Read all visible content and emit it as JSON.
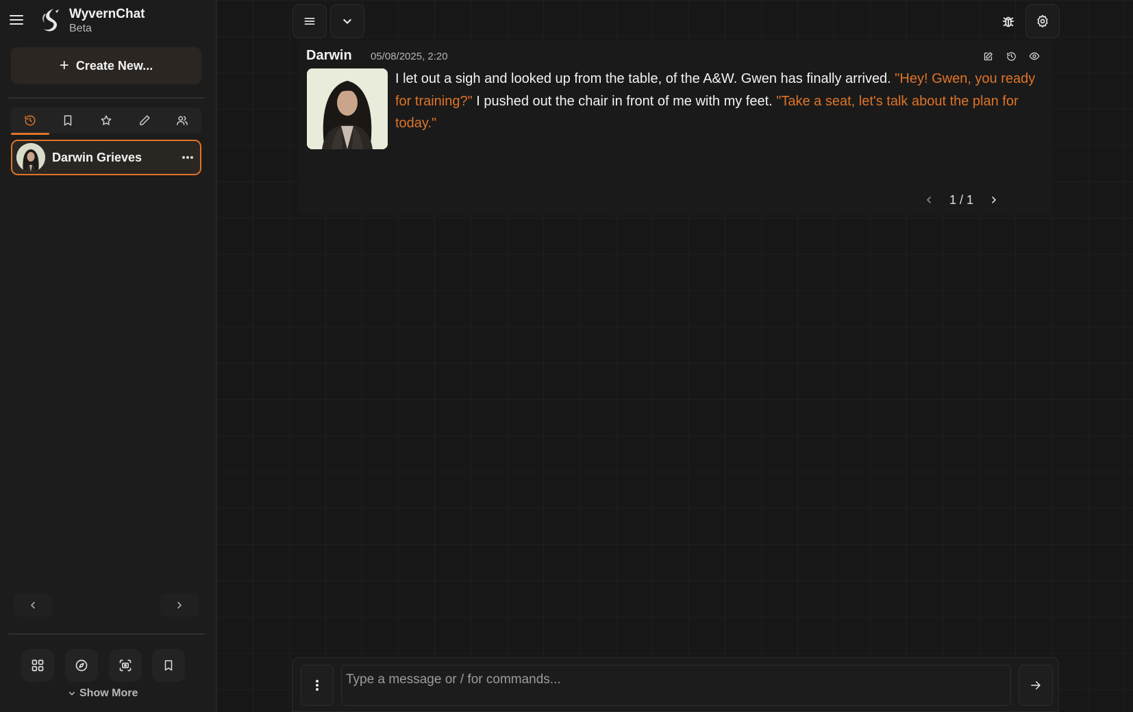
{
  "brand": {
    "name": "WyvernChat",
    "tag": "Beta"
  },
  "sidebar": {
    "create_label": "Create New...",
    "tabs": [
      {
        "name": "history-icon",
        "active": true
      },
      {
        "name": "bookmark-icon",
        "active": false
      },
      {
        "name": "star-icon",
        "active": false
      },
      {
        "name": "pencil-icon",
        "active": false
      },
      {
        "name": "users-icon",
        "active": false
      }
    ],
    "chats": [
      {
        "name": "Darwin Grieves",
        "selected": true
      }
    ],
    "bottom_nav": [
      "grid-icon",
      "compass-icon",
      "scan-icon",
      "bookmark-icon"
    ],
    "show_more": "Show More"
  },
  "message": {
    "author": "Darwin",
    "timestamp": "05/08/2025, 2:20",
    "segments": [
      {
        "text": "I let out a sigh and looked up from the table, of the A&W. Gwen has finally arrived. ",
        "quote": false
      },
      {
        "text": "\"Hey! Gwen, you ready for training?\"",
        "quote": true
      },
      {
        "text": " I pushed out the chair in front of me with my feet. ",
        "quote": false
      },
      {
        "text": "\"Take a seat, let's talk about the plan for today.\"",
        "quote": true
      }
    ],
    "pager": "1 / 1"
  },
  "composer": {
    "placeholder": "Type a message or / for commands..."
  },
  "colors": {
    "accent": "#e07428",
    "background": "#171717",
    "sidebar": "#1c1c1c"
  }
}
